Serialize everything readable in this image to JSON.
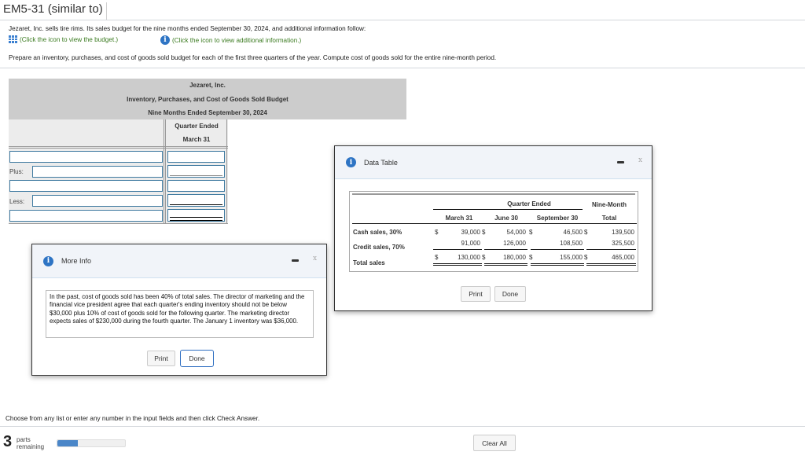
{
  "header": {
    "title": "EM5-31 (similar to)"
  },
  "intro": {
    "line1": "Jezaret, Inc. sells tire rims. Its sales budget for the nine months ended September 30, 2024, and additional information follow:",
    "budget_link": "(Click the icon to view the budget.)",
    "info_link": "(Click the icon to view additional information.)",
    "instruction": "Prepare an inventory, purchases, and cost of goods sold budget for each of the first three quarters of the year. Compute cost of goods sold for the entire nine-month period."
  },
  "budget": {
    "company": "Jezaret, Inc.",
    "title": "Inventory, Purchases, and Cost of Goods Sold Budget",
    "period": "Nine Months Ended September 30, 2024",
    "column_header_line1": "Quarter Ended",
    "column_header_line2": "March 31",
    "rows": [
      {
        "prefix": "",
        "label_value": "",
        "amount_value": ""
      },
      {
        "prefix": "Plus:",
        "label_value": "",
        "amount_value": ""
      },
      {
        "prefix": "",
        "label_value": "",
        "amount_value": ""
      },
      {
        "prefix": "Less:",
        "label_value": "",
        "amount_value": ""
      },
      {
        "prefix": "",
        "label_value": "",
        "amount_value": ""
      }
    ]
  },
  "data_table_dialog": {
    "title": "Data Table",
    "group_header": "Quarter Ended",
    "total_header_line1": "Nine-Month",
    "total_header_line2": "Total",
    "columns": [
      "March 31",
      "June 30",
      "September 30"
    ],
    "currency_symbol": "$",
    "rows": [
      {
        "label": "Cash sales, 30%",
        "values": [
          "39,000",
          "54,000",
          "46,500"
        ],
        "total": "139,500"
      },
      {
        "label": "Credit sales, 70%",
        "values": [
          "91,000",
          "126,000",
          "108,500"
        ],
        "total": "325,500"
      },
      {
        "label": "Total sales",
        "values": [
          "130,000",
          "180,000",
          "155,000"
        ],
        "total": "465,000"
      }
    ],
    "print_label": "Print",
    "done_label": "Done"
  },
  "more_info_dialog": {
    "title": "More Info",
    "text": "In the past, cost of goods sold has been 40% of total sales. The director of marketing and the financial vice president agree that each quarter's ending inventory should not be below $30,000 plus 10% of cost of goods sold for the following quarter. The marketing director expects sales of $230,000 during the fourth quarter. The January 1 inventory was $36,000.",
    "print_label": "Print",
    "done_label": "Done"
  },
  "footer": {
    "instruction": "Choose from any list or enter any number in the input fields and then click Check Answer.",
    "parts_count": "3",
    "parts_label_line1": "parts",
    "parts_label_line2": "remaining",
    "progress_percent": 30,
    "clear_all_label": "Clear All"
  },
  "colors": {
    "link_green": "#3a7a1f",
    "info_blue": "#2e74c4",
    "input_border": "#3f7aa0",
    "progress_fill": "#4a86c8"
  }
}
